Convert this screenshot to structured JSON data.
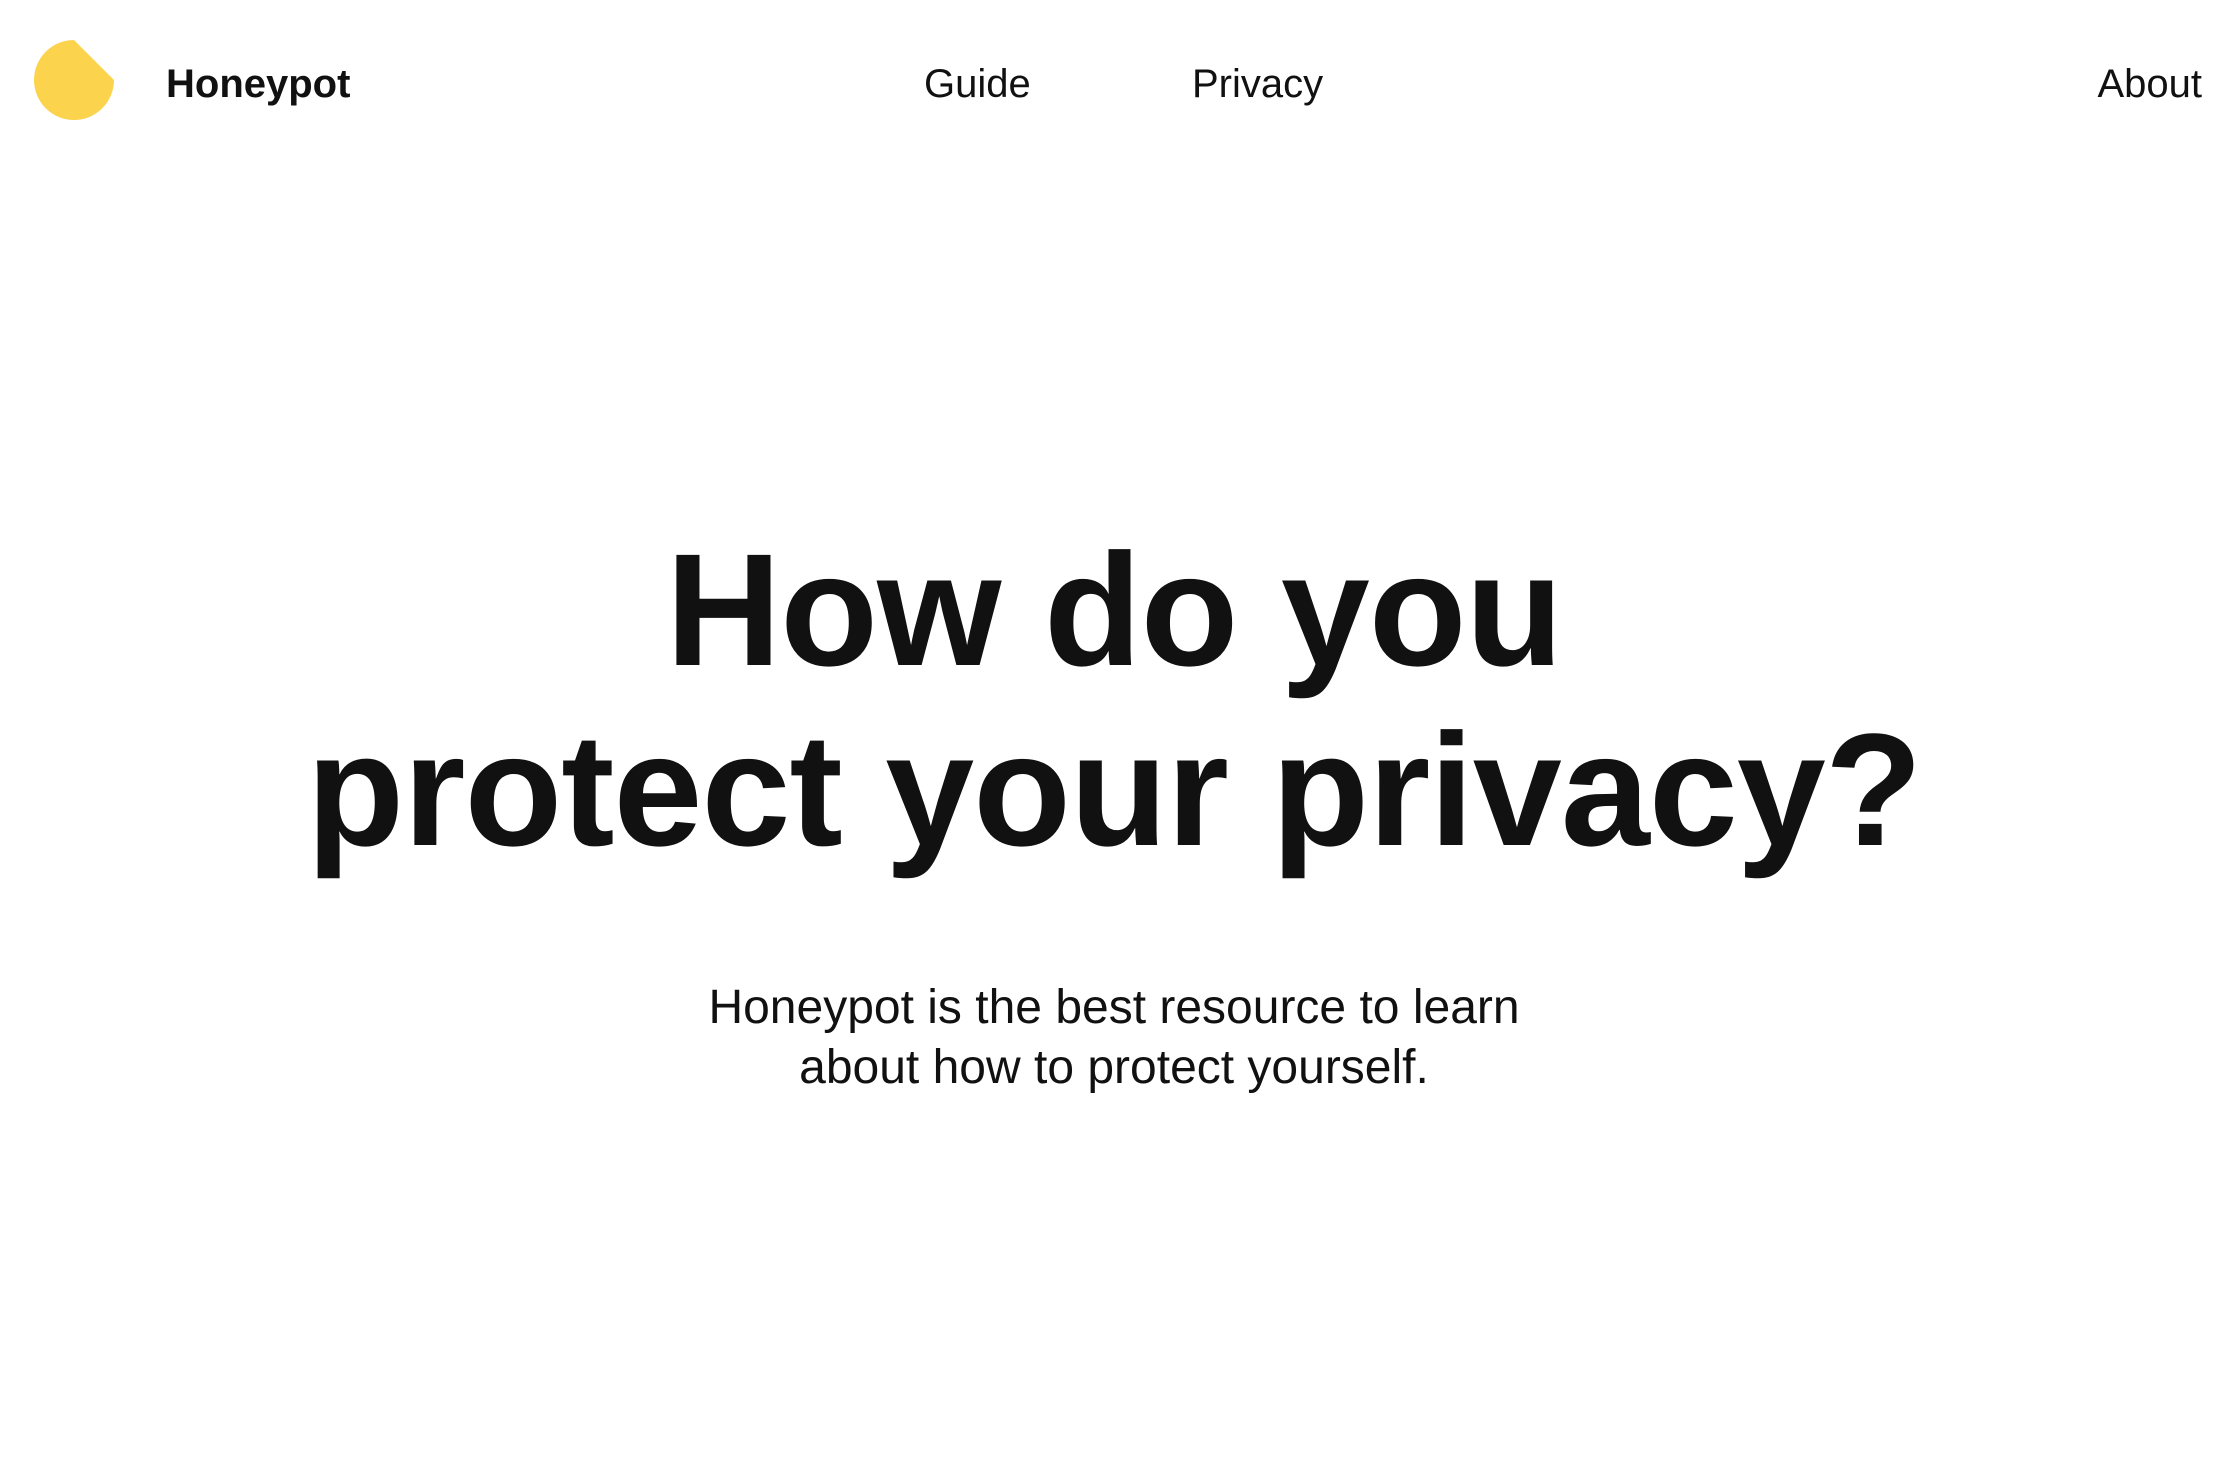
{
  "brand": {
    "name": "Honeypot",
    "logo_color": "#FBD34D",
    "logo_icon": "honeypot-logo-icon"
  },
  "nav": {
    "guide": "Guide",
    "privacy": "Privacy",
    "about": "About"
  },
  "hero": {
    "title_line1": "How do you",
    "title_line2": "protect your privacy?",
    "subtitle_line1": "Honeypot is the best resource to learn",
    "subtitle_line2": "about how to protect yourself."
  }
}
